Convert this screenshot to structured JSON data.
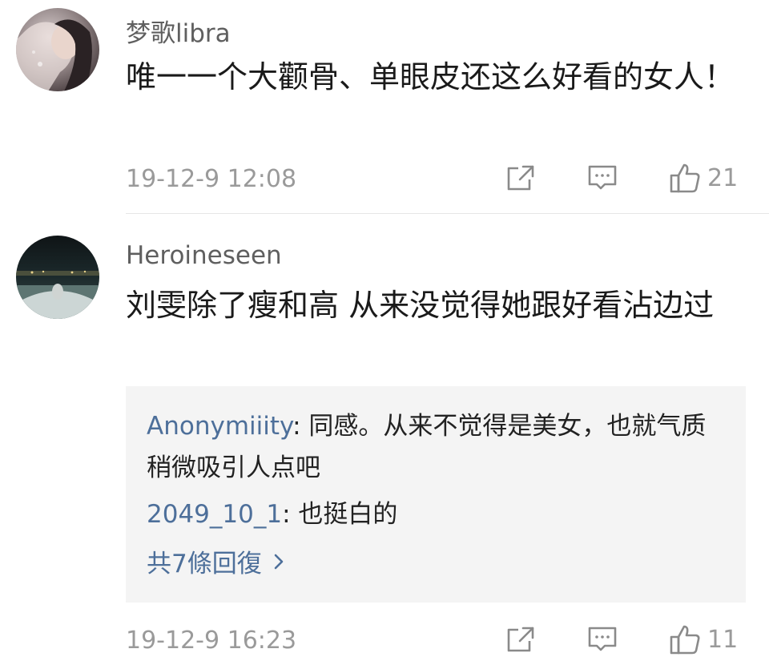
{
  "comments": [
    {
      "username": "梦歌libra",
      "text": "唯一一个大颧骨、单眼皮还这么好看的女人！",
      "timestamp": "19-12-9 12:08",
      "likes": "21",
      "avatar_icon": "user-avatar-photo"
    },
    {
      "username": "Heroineseen",
      "text": "刘雯除了瘦和高 从来没觉得她跟好看沾边过",
      "timestamp": "19-12-9 16:23",
      "likes": "11",
      "avatar_icon": "user-avatar-photo",
      "replies": [
        {
          "name": "Anonymiiity",
          "text": "同感。从来不觉得是美女，也就气质稍微吸引人点吧"
        },
        {
          "name": "2049_10_1",
          "text": "也挺白的"
        }
      ],
      "more_replies_label": "共7條回復"
    }
  ],
  "actions": {
    "share_icon": "share-icon",
    "reply_icon": "comment-icon",
    "like_icon": "thumbs-up-icon"
  },
  "colors": {
    "username": "#5f5f5f",
    "meta": "#9a9a9a",
    "reply_name": "#4d6f9a",
    "reply_bg": "#f4f4f4"
  }
}
